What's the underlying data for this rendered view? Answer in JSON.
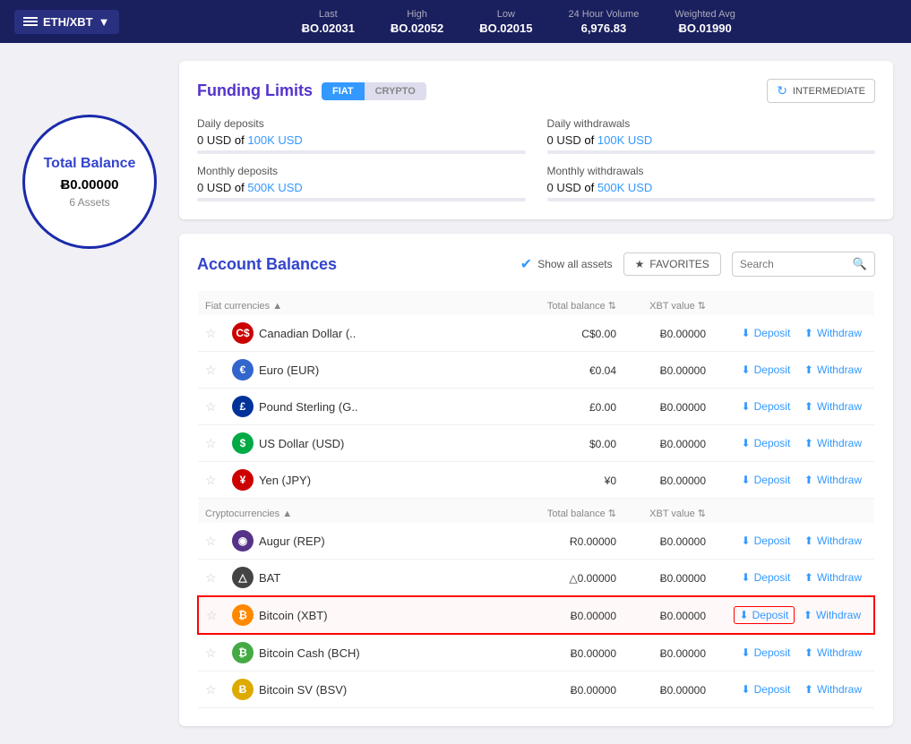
{
  "topbar": {
    "pair": "ETH/XBT",
    "stats": [
      {
        "label": "Last",
        "value": "ɃO.02031"
      },
      {
        "label": "High",
        "value": "ɃO.02052"
      },
      {
        "label": "Low",
        "value": "ɃO.02015"
      },
      {
        "label": "24 Hour Volume",
        "value": "6,976.83"
      },
      {
        "label": "Weighted Avg",
        "value": "ɃO.01990"
      }
    ]
  },
  "totalBalance": {
    "title": "Total Balance",
    "amount": "Ƀ0.00000",
    "assets": "6 Assets"
  },
  "fundingLimits": {
    "title": "Funding Limits",
    "tabs": [
      {
        "label": "FIAT",
        "active": true
      },
      {
        "label": "CRYPTO",
        "active": false
      }
    ],
    "intermediateLabel": "INTERMEDIATE",
    "rows": [
      {
        "label": "Daily deposits",
        "used": "0 USD",
        "of": "of",
        "total": "100K USD",
        "fill": 0
      },
      {
        "label": "Daily withdrawals",
        "used": "0 USD",
        "of": "of",
        "total": "100K USD",
        "fill": 0
      },
      {
        "label": "Monthly deposits",
        "used": "0 USD",
        "of": "of",
        "total": "500K USD",
        "fill": 0
      },
      {
        "label": "Monthly withdrawals",
        "used": "0 USD",
        "of": "of",
        "total": "500K USD",
        "fill": 0
      }
    ]
  },
  "accountBalances": {
    "title": "Account Balances",
    "showAllLabel": "Show all assets",
    "favoritesLabel": "FAVORITES",
    "searchPlaceholder": "Search",
    "fiatSection": {
      "label": "Fiat currencies",
      "colTotal": "Total balance",
      "colXbt": "XBT value"
    },
    "cryptoSection": {
      "label": "Cryptocurrencies",
      "colTotal": "Total balance",
      "colXbt": "XBT value"
    },
    "fiatRows": [
      {
        "id": "cad",
        "name": "Canadian Dollar (..",
        "iconClass": "icon-cad",
        "iconText": "C$",
        "total": "C$0.00",
        "xbt": "Ƀ0.00000",
        "deposit": "Deposit",
        "withdraw": "Withdraw",
        "highlighted": false
      },
      {
        "id": "eur",
        "name": "Euro (EUR)",
        "iconClass": "icon-eur",
        "iconText": "€",
        "total": "€0.04",
        "xbt": "Ƀ0.00000",
        "deposit": "Deposit",
        "withdraw": "Withdraw",
        "highlighted": false
      },
      {
        "id": "gbp",
        "name": "Pound Sterling (G..",
        "iconClass": "icon-gbp",
        "iconText": "£",
        "total": "£0.00",
        "xbt": "Ƀ0.00000",
        "deposit": "Deposit",
        "withdraw": "Withdraw",
        "highlighted": false
      },
      {
        "id": "usd",
        "name": "US Dollar (USD)",
        "iconClass": "icon-usd",
        "iconText": "$",
        "total": "$0.00",
        "xbt": "Ƀ0.00000",
        "deposit": "Deposit",
        "withdraw": "Withdraw",
        "highlighted": false
      },
      {
        "id": "jpy",
        "name": "Yen (JPY)",
        "iconClass": "icon-jpy",
        "iconText": "¥",
        "total": "¥0",
        "xbt": "Ƀ0.00000",
        "deposit": "Deposit",
        "withdraw": "Withdraw",
        "highlighted": false
      }
    ],
    "cryptoRows": [
      {
        "id": "rep",
        "name": "Augur (REP)",
        "iconClass": "icon-rep",
        "iconText": "◉",
        "total": "Ɍ0.00000",
        "xbt": "Ƀ0.00000",
        "deposit": "Deposit",
        "withdraw": "Withdraw",
        "highlighted": false
      },
      {
        "id": "bat",
        "name": "BAT",
        "iconClass": "icon-bat",
        "iconText": "△",
        "total": "△0.00000",
        "xbt": "Ƀ0.00000",
        "deposit": "Deposit",
        "withdraw": "Withdraw",
        "highlighted": false
      },
      {
        "id": "xbt",
        "name": "Bitcoin (XBT)",
        "iconClass": "icon-xbt",
        "iconText": "₿",
        "total": "Ƀ0.00000",
        "xbt": "Ƀ0.00000",
        "deposit": "Deposit",
        "withdraw": "Withdraw",
        "highlighted": true
      },
      {
        "id": "bch",
        "name": "Bitcoin Cash (BCH)",
        "iconClass": "icon-bch",
        "iconText": "₿",
        "total": "Ƀ0.00000",
        "xbt": "Ƀ0.00000",
        "deposit": "Deposit",
        "withdraw": "Withdraw",
        "highlighted": false
      },
      {
        "id": "bsv",
        "name": "Bitcoin SV (BSV)",
        "iconClass": "icon-bsv",
        "iconText": "Ƀ",
        "total": "Ƀ0.00000",
        "xbt": "Ƀ0.00000",
        "deposit": "Deposit",
        "withdraw": "Withdraw",
        "highlighted": false
      }
    ]
  }
}
